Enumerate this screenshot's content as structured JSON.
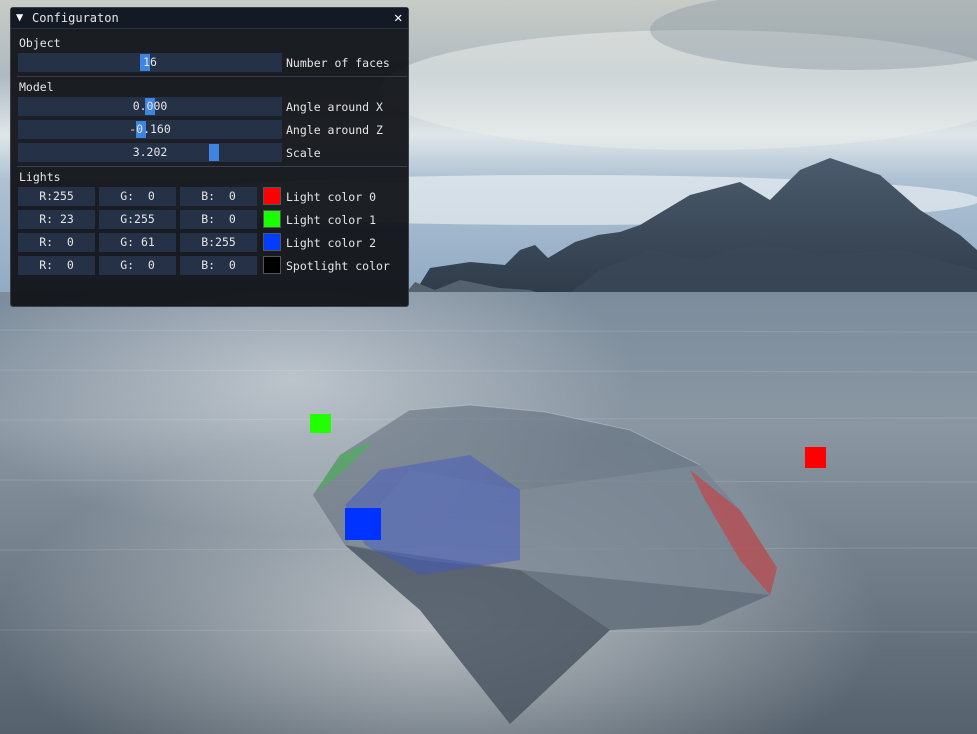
{
  "window": {
    "title": "Configuraton"
  },
  "object_section": {
    "header": "Object",
    "faces": {
      "label": "Number of faces",
      "value": "16",
      "fraction": 0.48
    }
  },
  "model_section": {
    "header": "Model",
    "angle_x": {
      "label": "Angle around X",
      "value": "0.000",
      "fraction": 0.5
    },
    "angle_z": {
      "label": "Angle around Z",
      "value": "-0.160",
      "fraction": 0.465
    },
    "scale": {
      "label": "Scale",
      "value": "3.202",
      "fraction": 0.75
    }
  },
  "lights_section": {
    "header": "Lights",
    "rows": [
      {
        "label": "Light color 0",
        "r": "R:255",
        "g": "G:  0",
        "b": "B:  0",
        "color": "#ff0000"
      },
      {
        "label": "Light color 1",
        "r": "R: 23",
        "g": "G:255",
        "b": "B:  0",
        "color": "#17ff00"
      },
      {
        "label": "Light color 2",
        "r": "R:  0",
        "g": "G: 61",
        "b": "B:255",
        "color": "#003dff"
      },
      {
        "label": "Spotlight color",
        "r": "R:  0",
        "g": "G:  0",
        "b": "B:  0",
        "color": "#000000"
      }
    ]
  },
  "colors": {
    "accent": "#3d85e0",
    "frame_bg": "#243146",
    "window_bg": "#0e1014"
  }
}
